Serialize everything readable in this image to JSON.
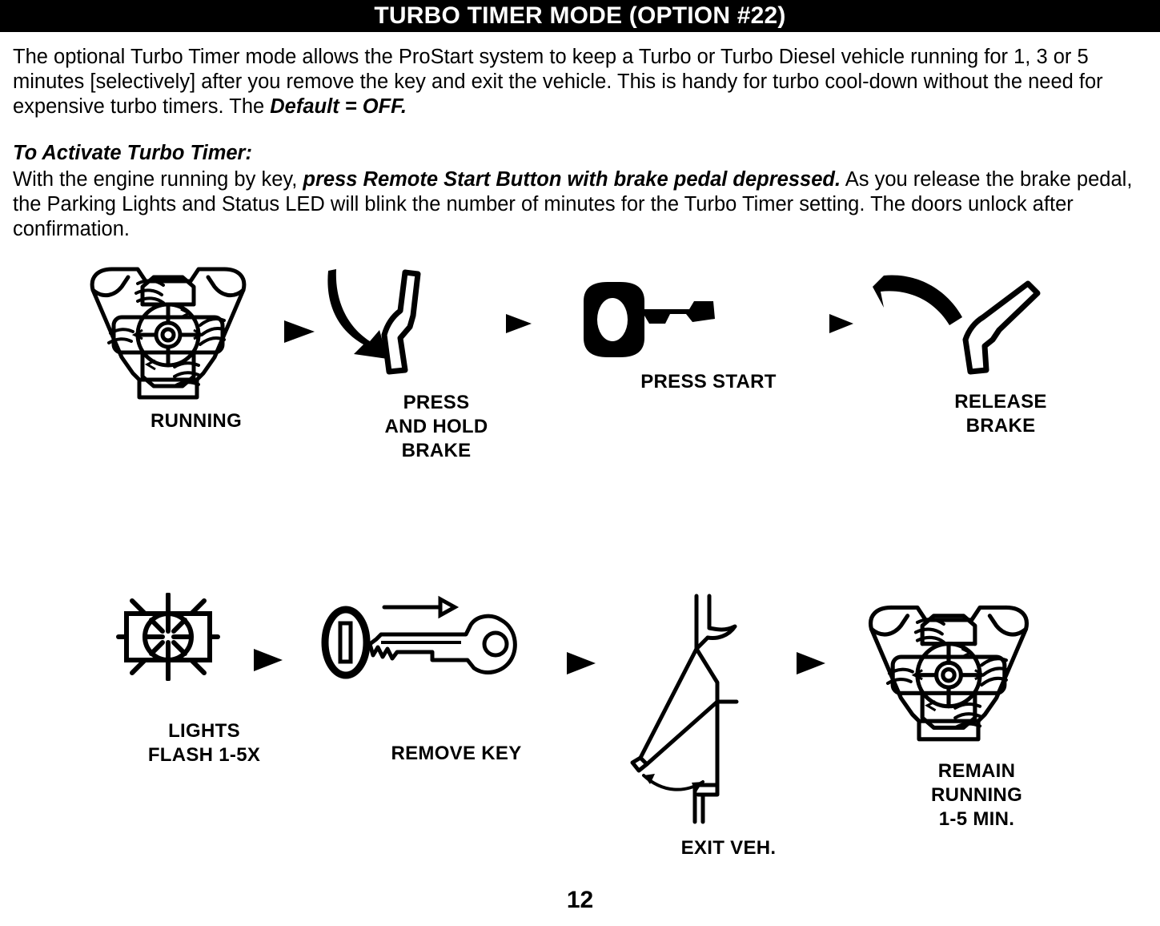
{
  "header": {
    "title": "TURBO TIMER MODE (OPTION #22)"
  },
  "body": {
    "intro_part1": "The optional Turbo Timer mode allows the ProStart system to keep a Turbo or Turbo Diesel vehicle running for 1, 3 or 5 minutes [selectively] after you remove the key and exit the vehicle. This is handy for turbo cool-down without the need for expensive turbo timers. The ",
    "intro_emphasis": "Default = OFF.",
    "activate_heading": "To Activate Turbo Timer:",
    "activate_part1": "With the engine running by key, ",
    "activate_emphasis": "press Remote Start Button with brake pedal depressed.",
    "activate_part2": " As you release the brake pedal, the Parking Lights and Status LED will blink the number of minutes for the Turbo Timer setting. The doors unlock after confirmation."
  },
  "flow": {
    "row1": [
      {
        "icon": "engine-running-icon",
        "label": "RUNNING"
      },
      {
        "icon": "brake-pedal-press-icon",
        "label": "PRESS\nAND HOLD\nBRAKE"
      },
      {
        "icon": "key-solid-icon",
        "label": "PRESS START"
      },
      {
        "icon": "brake-pedal-release-icon",
        "label": "RELEASE\nBRAKE"
      }
    ],
    "row2": [
      {
        "icon": "parking-light-flash-icon",
        "label": "LIGHTS\nFLASH 1-5X"
      },
      {
        "icon": "key-removal-icon",
        "label": "REMOVE KEY"
      },
      {
        "icon": "car-door-open-icon",
        "label": "EXIT VEH."
      },
      {
        "icon": "engine-running-icon",
        "label": "REMAIN\nRUNNING\n1-5 MIN."
      }
    ],
    "arrow_icon": "triangle-right-arrow-icon"
  },
  "footer": {
    "page_number": "12"
  },
  "colors": {
    "ink": "#000000",
    "paper": "#ffffff",
    "header_text": "#ffffff"
  }
}
